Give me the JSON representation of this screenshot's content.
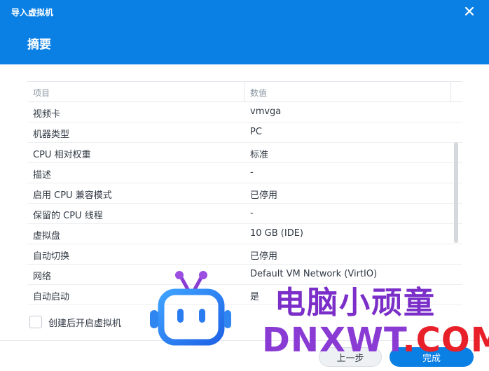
{
  "window": {
    "title": "导入虚拟机",
    "section_title": "摘要"
  },
  "table": {
    "headers": [
      "项目",
      "数值"
    ],
    "rows": [
      {
        "item": "视频卡",
        "value": "vmvga"
      },
      {
        "item": "机器类型",
        "value": "PC"
      },
      {
        "item": "CPU 相对权重",
        "value": "标准"
      },
      {
        "item": "描述",
        "value": "-"
      },
      {
        "item": "启用 CPU 兼容模式",
        "value": "已停用"
      },
      {
        "item": "保留的 CPU 线程",
        "value": "-"
      },
      {
        "item": "虚拟盘",
        "value": "10 GB (IDE)"
      },
      {
        "item": "自动切换",
        "value": "已停用"
      },
      {
        "item": "网络",
        "value": "Default VM Network (VirtIO)"
      },
      {
        "item": "自动启动",
        "value": "是"
      }
    ]
  },
  "footer": {
    "checkbox_label": "创建后开启虚拟机",
    "checkbox_checked": false,
    "back_button": "上一步",
    "finish_button": "完成"
  },
  "watermark": {
    "text_cn": "电脑小顽童",
    "text_en_main": "DNXWT",
    "text_en_suffix": ".COM"
  },
  "colors": {
    "header_blue": "#0a7fe4",
    "watermark_purple": "#7b2fc8",
    "watermark_red": "#e8202a"
  },
  "icons": {
    "close": "close-icon",
    "robot": "robot-logo"
  }
}
